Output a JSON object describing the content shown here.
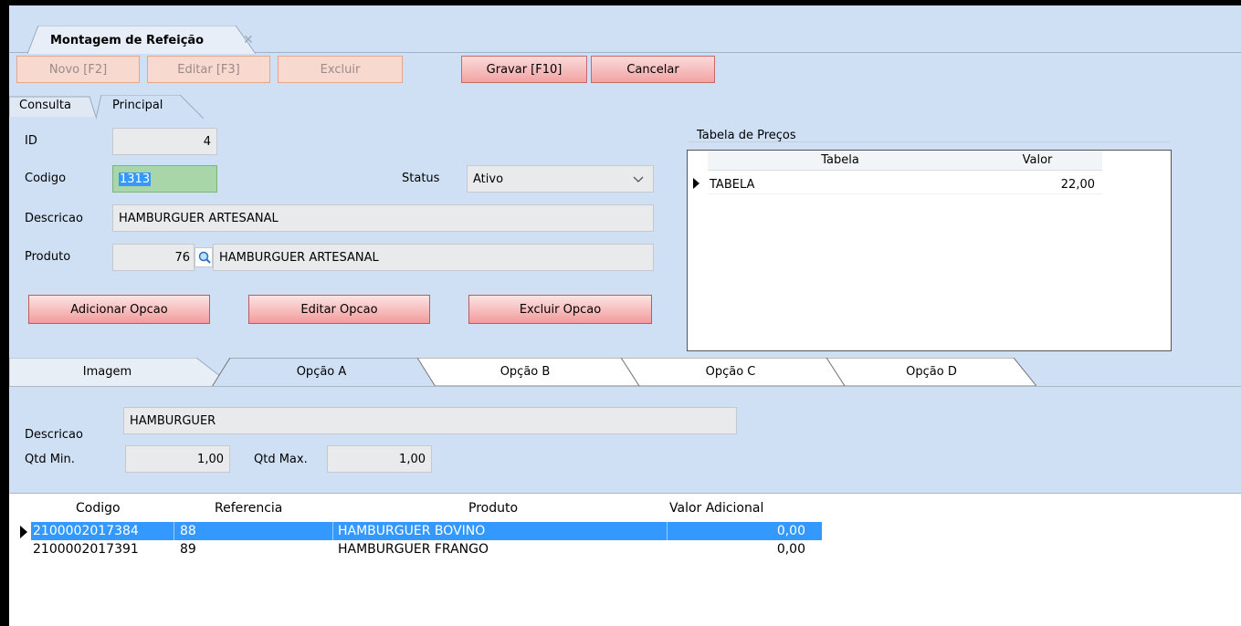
{
  "document_tab": {
    "title": "Montagem de Refeição",
    "close_glyph": "✕"
  },
  "toolbar": {
    "novo": "Novo [F2]",
    "editar": "Editar [F3]",
    "excluir": "Excluir",
    "gravar": "Gravar [F10]",
    "cancelar": "Cancelar"
  },
  "inner_tabs": {
    "consulta": "Consulta",
    "principal": "Principal"
  },
  "form": {
    "id_label": "ID",
    "id_value": "4",
    "codigo_label": "Codigo",
    "codigo_value": "1313",
    "status_label": "Status",
    "status_value": "Ativo",
    "descricao_label": "Descricao",
    "descricao_value": "HAMBURGUER ARTESANAL",
    "produto_label": "Produto",
    "produto_code": "76",
    "produto_name": "HAMBURGUER ARTESANAL"
  },
  "option_buttons": {
    "adicionar": "Adicionar Opcao",
    "editar": "Editar Opcao",
    "excluir": "Excluir Opcao"
  },
  "price_table": {
    "title": "Tabela de Preços",
    "columns": [
      "Tabela",
      "Valor"
    ],
    "rows": [
      {
        "tabela": "TABELA",
        "valor": "22,00"
      }
    ]
  },
  "bottom_tabs": [
    "Imagem",
    "Opção A",
    "Opção B",
    "Opção C",
    "Opção D"
  ],
  "option_a": {
    "descricao_label": "Descricao",
    "descricao_value": "HAMBURGUER",
    "qtd_min_label": "Qtd Min.",
    "qtd_min_value": "1,00",
    "qtd_max_label": "Qtd Max.",
    "qtd_max_value": "1,00"
  },
  "grid": {
    "columns": [
      "Codigo",
      "Referencia",
      "Produto",
      "Valor Adicional"
    ],
    "rows": [
      {
        "codigo": "2100002017384",
        "referencia": "88",
        "produto": "HAMBURGUER BOVINO",
        "valor": "0,00",
        "selected": true
      },
      {
        "codigo": "2100002017391",
        "referencia": "89",
        "produto": "HAMBURGUER FRANGO",
        "valor": "0,00",
        "selected": false
      }
    ]
  },
  "colors": {
    "panel_bg": "#cfe0f5",
    "selection": "#3399ff",
    "codigo_field": "#a9d6a9"
  },
  "icons": {
    "lookup": "search-icon",
    "dropdown": "chevron-down-icon",
    "row_marker": "row-pointer-icon"
  }
}
